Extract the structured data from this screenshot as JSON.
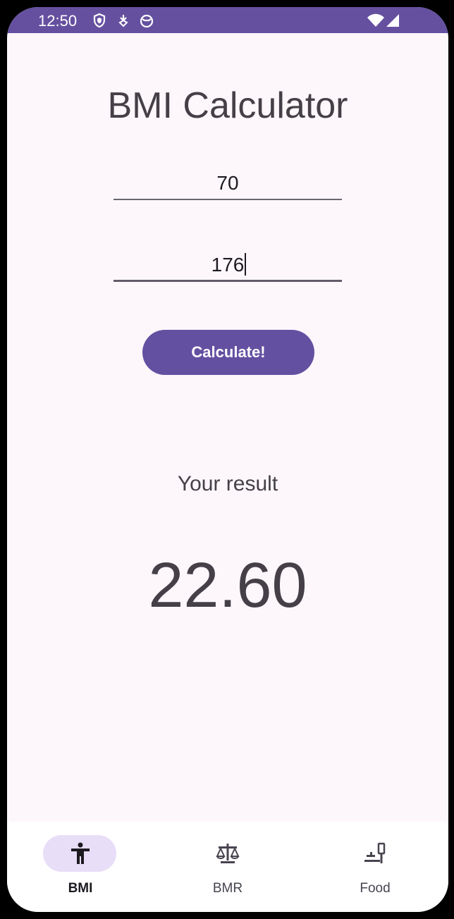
{
  "status_bar": {
    "time": "12:50",
    "icons": [
      "shield-icon",
      "download-icon",
      "cat-face-icon"
    ],
    "right_icons": [
      "wifi-icon",
      "signal-icon"
    ],
    "color": "#6550a0"
  },
  "screen": {
    "title": "BMI Calculator"
  },
  "form": {
    "weight_value": "70",
    "height_value": "176",
    "calculate_label": "Calculate!"
  },
  "result": {
    "label": "Your result",
    "value": "22.60"
  },
  "bottom_nav": {
    "items": [
      {
        "label": "BMI",
        "icon": "accessibility-person-icon",
        "active": true
      },
      {
        "label": "BMR",
        "icon": "balance-scale-icon",
        "active": false
      },
      {
        "label": "Food",
        "icon": "food-table-icon",
        "active": false
      }
    ],
    "active_indicator_color": "#e8def8"
  },
  "colors": {
    "accent": "#6450a1",
    "background": "#fdf7fc",
    "text": "#454048"
  }
}
